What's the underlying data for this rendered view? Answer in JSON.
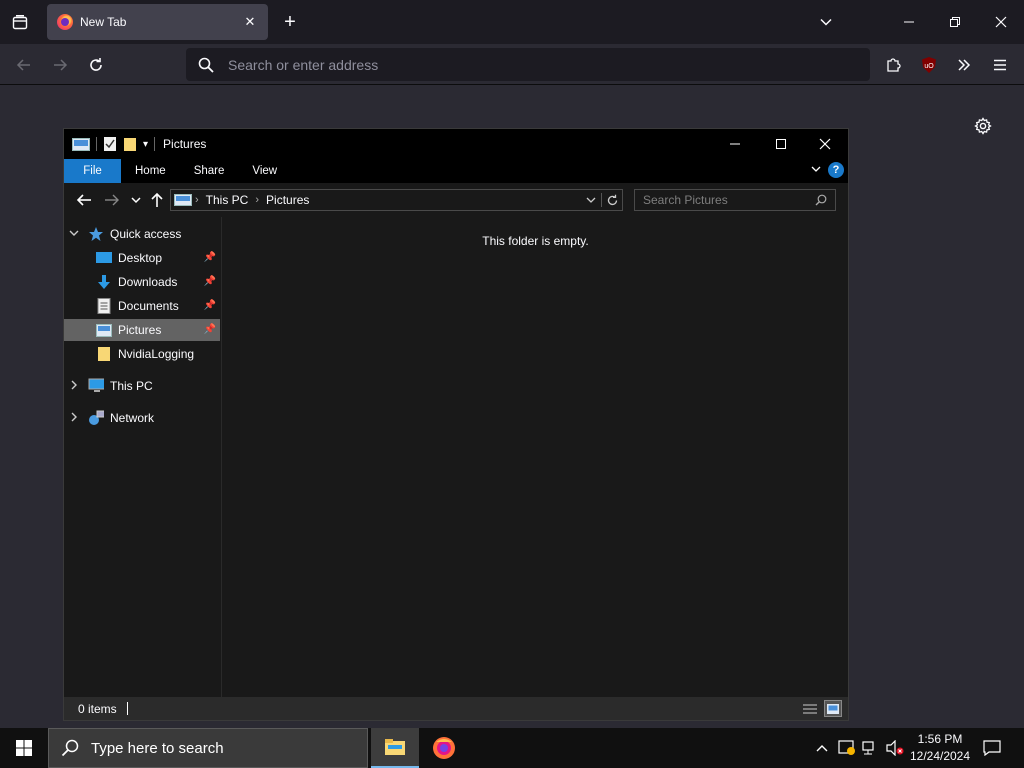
{
  "browser": {
    "tab_title": "New Tab",
    "url_placeholder": "Search or enter address"
  },
  "explorer": {
    "window_title": "Pictures",
    "ribbon_tabs": [
      "File",
      "Home",
      "Share",
      "View"
    ],
    "breadcrumb": [
      "This PC",
      "Pictures"
    ],
    "search_placeholder": "Search Pictures",
    "nav_items": {
      "quick_access": "Quick access",
      "desktop": "Desktop",
      "downloads": "Downloads",
      "documents": "Documents",
      "pictures": "Pictures",
      "nvidia": "NvidiaLogging",
      "this_pc": "This PC",
      "network": "Network"
    },
    "empty_message": "This folder is empty.",
    "status_count": "0 items"
  },
  "taskbar": {
    "search_placeholder": "Type here to search",
    "time": "1:56 PM",
    "date": "12/24/2024"
  },
  "colors": {
    "accent": "#1979ca",
    "selection": "#636363"
  }
}
